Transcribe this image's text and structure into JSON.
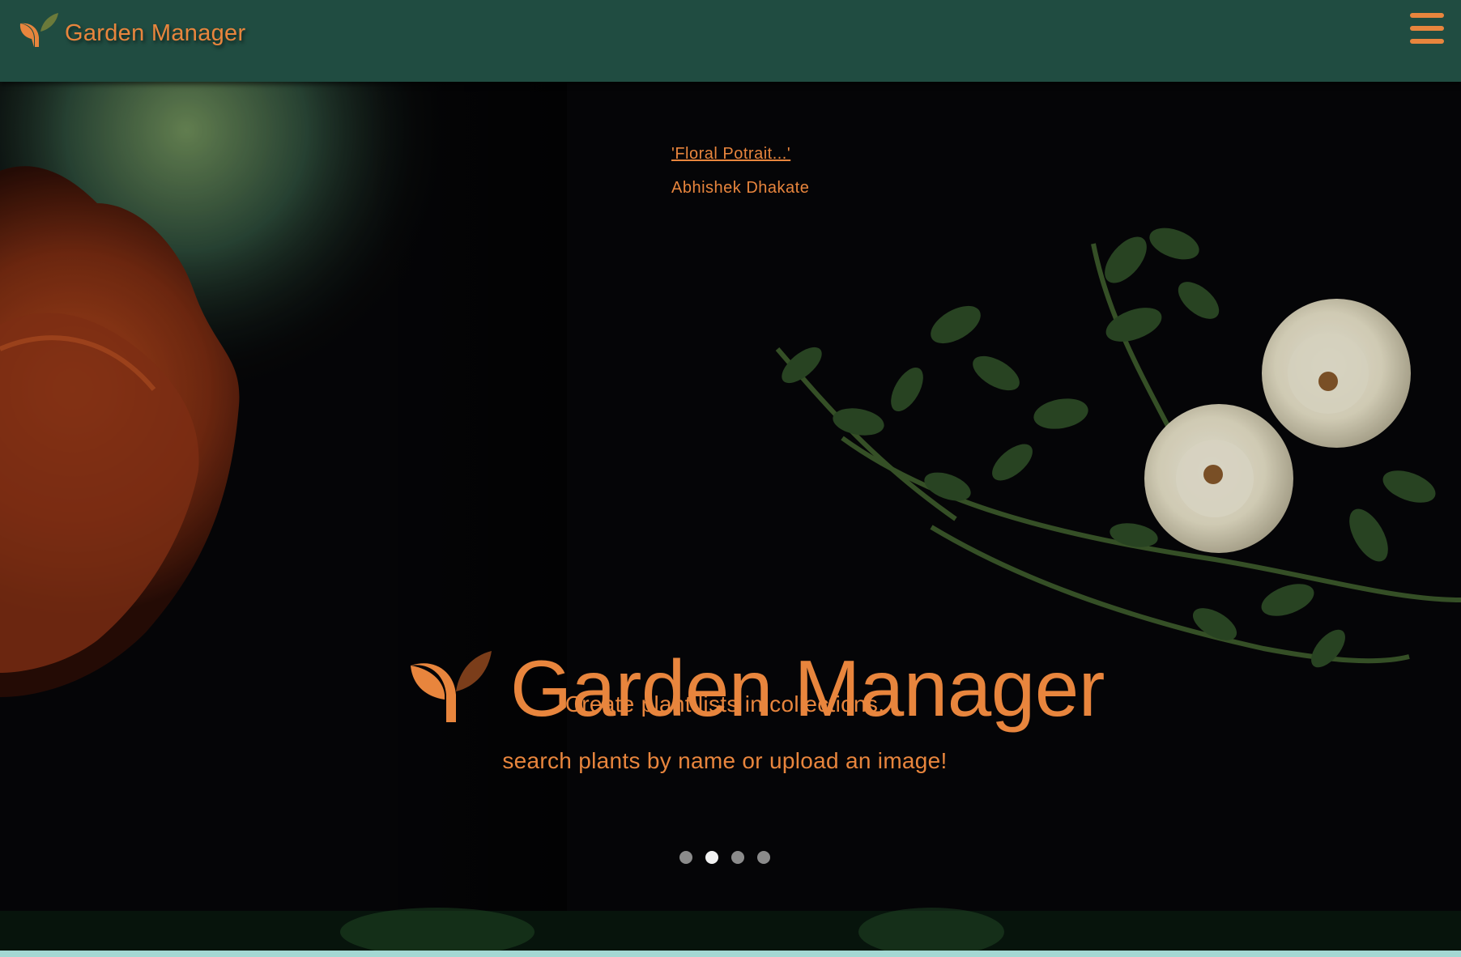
{
  "navbar": {
    "brand_label": "Garden Manager",
    "logo_icon": "sprout-icon",
    "menu_icon": "hamburger-menu-icon",
    "background_color": "#204c41",
    "accent_color": "#e8853d"
  },
  "hero": {
    "photo_title": "'Floral Potrait...'",
    "photo_author": "Abhishek Dhakate",
    "title": "Garden Manager",
    "tagline_line1": "Create plant lists in collections,",
    "tagline_line2": "search plants by name or upload an image!",
    "carousel": {
      "total_slides": 4,
      "active_slide": 2
    }
  },
  "footer": {
    "strip_color": "#a3d8d3"
  }
}
